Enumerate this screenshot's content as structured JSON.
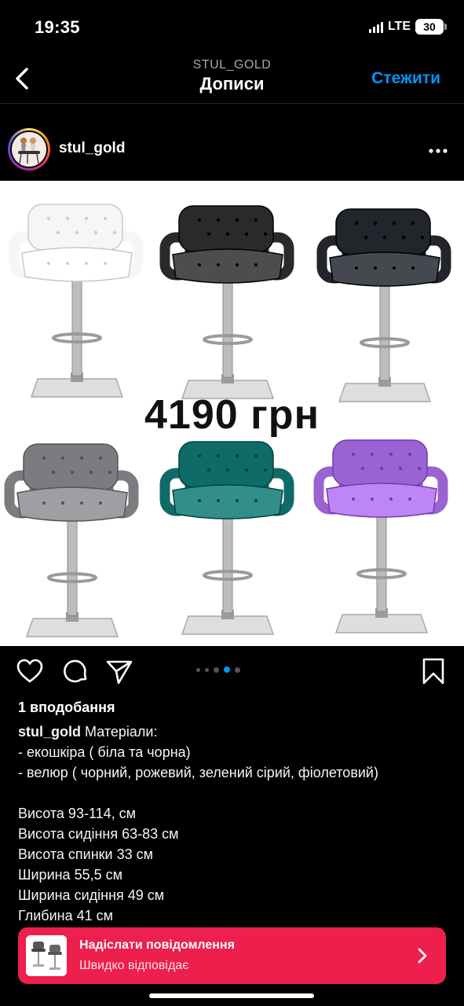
{
  "status": {
    "time": "19:35",
    "network": "LTE",
    "battery": "30"
  },
  "nav": {
    "subtitle": "STUL_GOLD",
    "title": "Дописи",
    "follow_label": "Стежити",
    "back_icon": "chevron-left-icon"
  },
  "post": {
    "username": "stul_gold",
    "more_icon": "more-horizontal-icon",
    "image": {
      "price": "4190 грн",
      "chair_colors": [
        "#f6f6f6",
        "#2a2a2c",
        "#23252c",
        "#7b7c80",
        "#0f6b67",
        "#9a62d3"
      ]
    },
    "carousel": {
      "count": 5,
      "active_index": 3
    },
    "likes": "1 вподобання",
    "caption_user": "stul_gold",
    "caption_first": "Матеріали:",
    "caption_lines": [
      "- екошкіра ( біла та чорна)",
      "- велюр ( чорний, рожевий, зелений сірий, фіолетовий)",
      "",
      "Висота 93-114, см",
      "Висота сидіння 63-83 см",
      "Висота спинки 33 см",
      "Ширина 55,5 см",
      "Ширина сидіння 49 см",
      "Глибина 41 см"
    ]
  },
  "cta": {
    "title": "Надіслати повідомлення",
    "subtitle": "Швидко відповідає",
    "color": "#ed1f4c"
  },
  "colors": {
    "accent": "#0095f6",
    "background": "#000000"
  }
}
